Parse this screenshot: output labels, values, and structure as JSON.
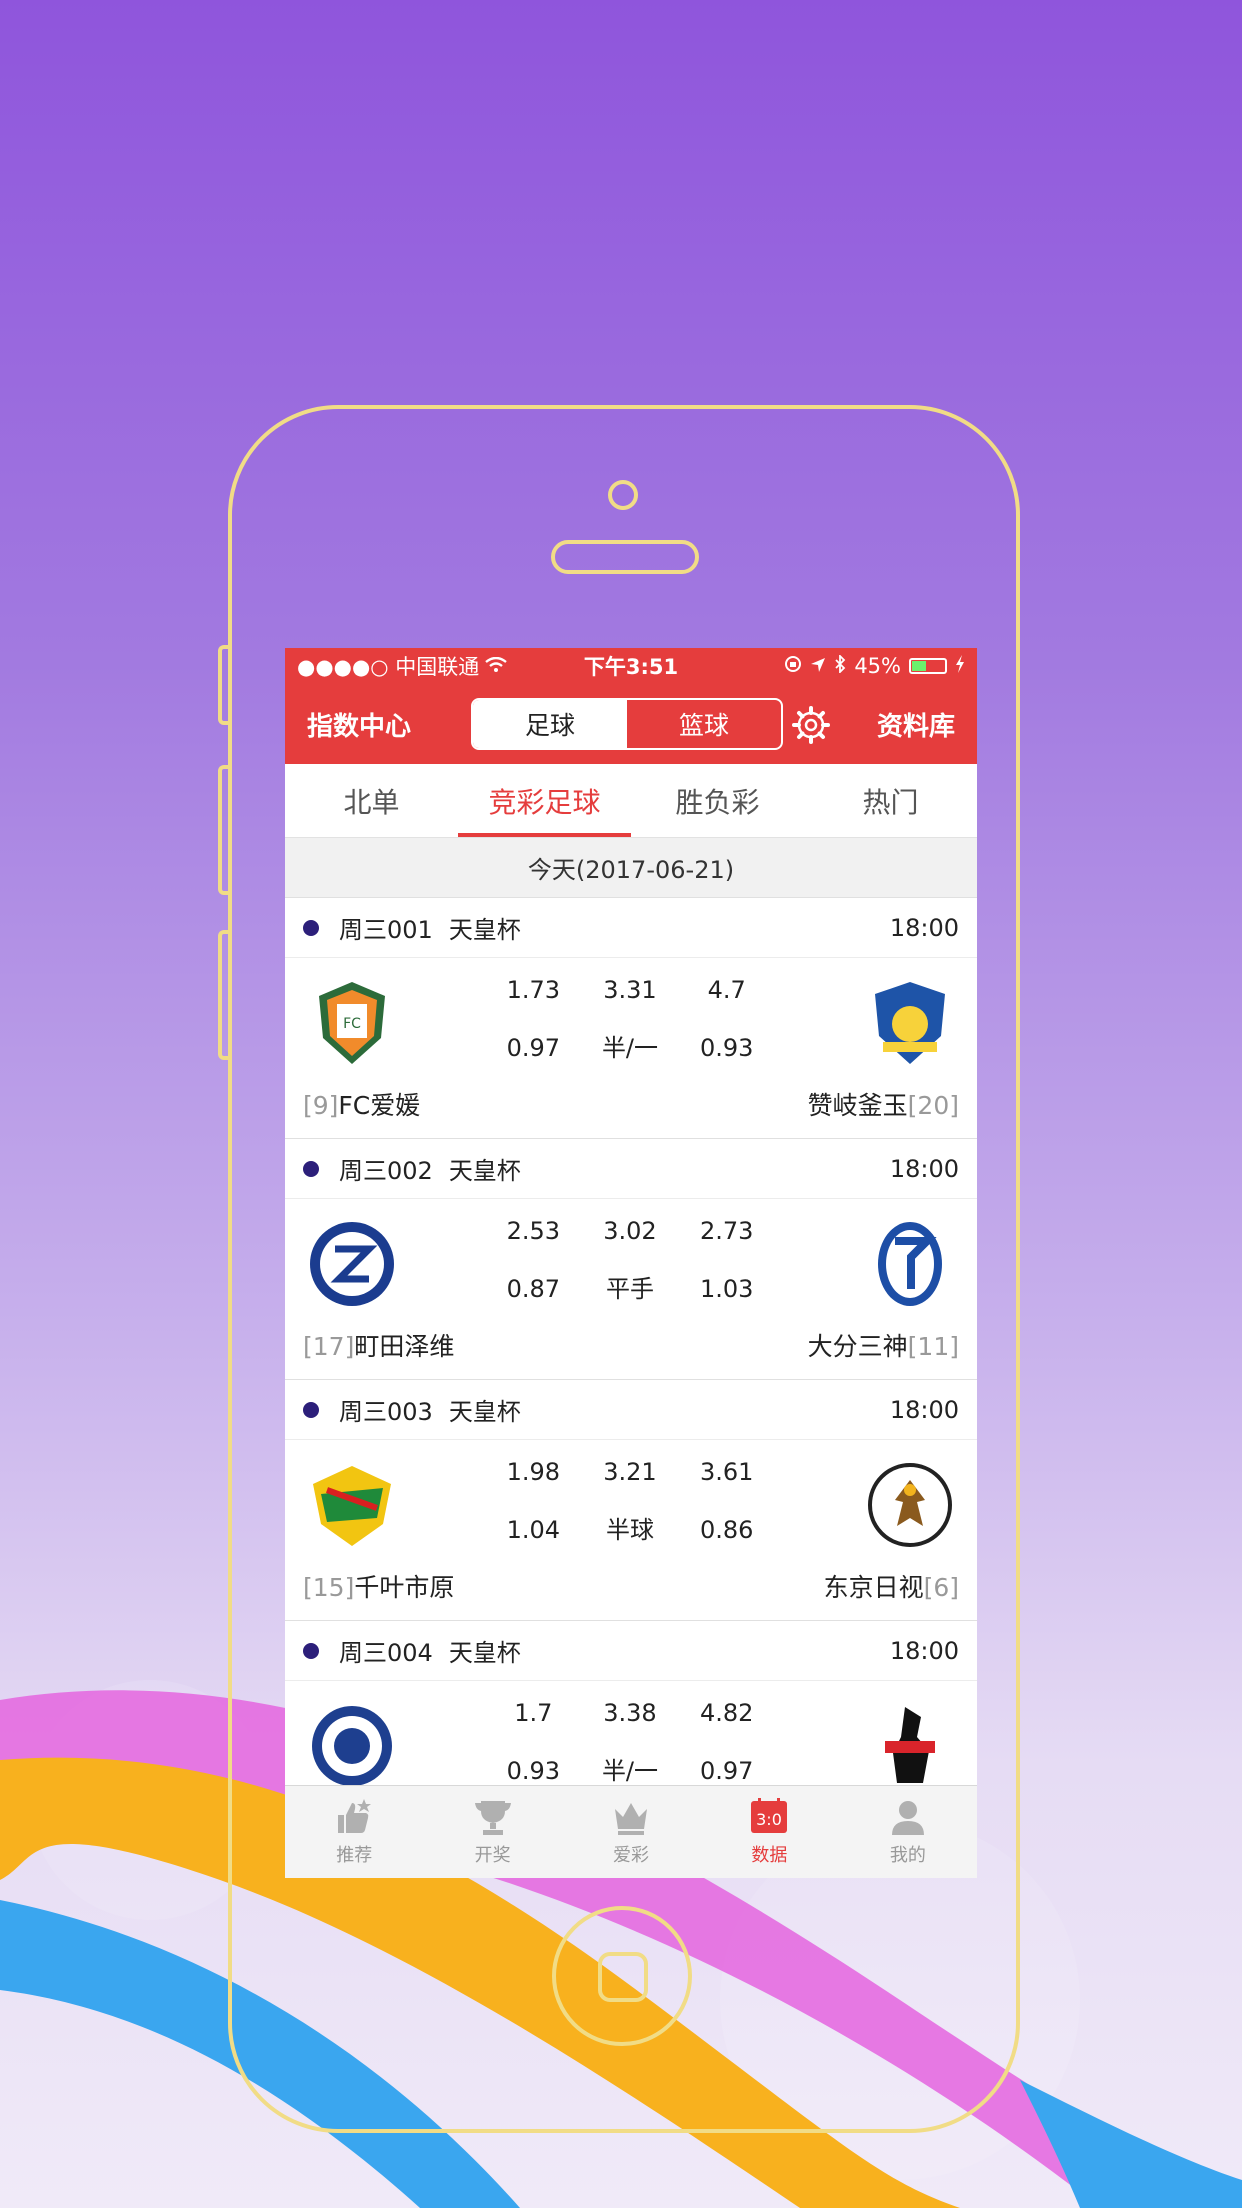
{
  "status_bar": {
    "carrier": "●●●●○ 中国联通",
    "time": "下午3:51",
    "battery": "45%",
    "battery_level": 0.45
  },
  "navbar": {
    "title": "指数中心",
    "seg_left": "足球",
    "seg_right": "篮球",
    "right_link": "资料库"
  },
  "tabs": [
    "北单",
    "竞彩足球",
    "胜负彩",
    "热门"
  ],
  "date_label": "今天(2017-06-21)",
  "matches": [
    {
      "code": "周三001",
      "cup": "天皇杯",
      "time": "18:00",
      "odds": [
        "1.73",
        "3.31",
        "4.7",
        "0.97",
        "半/一",
        "0.93"
      ],
      "home_rank": "[9]",
      "home": "FC爱媛",
      "away": "赞岐釜玉",
      "away_rank": "[20]"
    },
    {
      "code": "周三002",
      "cup": "天皇杯",
      "time": "18:00",
      "odds": [
        "2.53",
        "3.02",
        "2.73",
        "0.87",
        "平手",
        "1.03"
      ],
      "home_rank": "[17]",
      "home": "町田泽维",
      "away": "大分三神",
      "away_rank": "[11]"
    },
    {
      "code": "周三003",
      "cup": "天皇杯",
      "time": "18:00",
      "odds": [
        "1.98",
        "3.21",
        "3.61",
        "1.04",
        "半球",
        "0.86"
      ],
      "home_rank": "[15]",
      "home": "千叶市原",
      "away": "东京日视",
      "away_rank": "[6]"
    },
    {
      "code": "周三004",
      "cup": "天皇杯",
      "time": "18:00",
      "odds": [
        "1.7",
        "3.38",
        "4.82",
        "0.93",
        "半/一",
        "0.97"
      ],
      "home_rank": "",
      "home": "",
      "away": "",
      "away_rank": ""
    }
  ],
  "bottom_nav": [
    {
      "label": "推荐",
      "icon": "thumb-up-icon"
    },
    {
      "label": "开奖",
      "icon": "trophy-icon"
    },
    {
      "label": "爱彩",
      "icon": "crown-icon"
    },
    {
      "label": "数据",
      "icon": "score-icon",
      "badge": "3:0"
    },
    {
      "label": "我的",
      "icon": "user-icon"
    }
  ],
  "colors": {
    "accent": "#e53d3d",
    "frame": "#f1dc86"
  }
}
